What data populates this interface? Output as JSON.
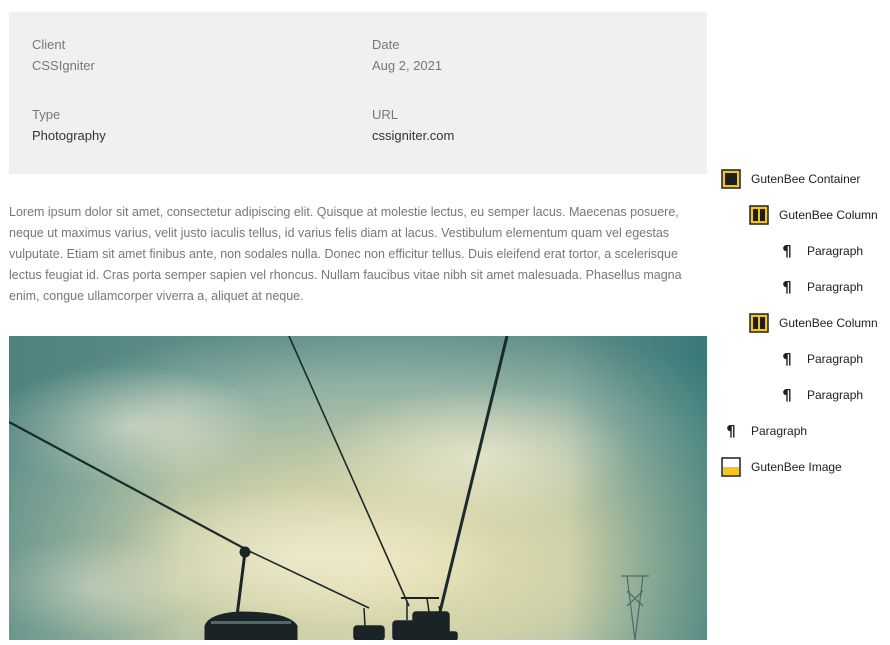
{
  "meta": {
    "client": {
      "label": "Client",
      "value": "CSSIgniter"
    },
    "date": {
      "label": "Date",
      "value": "Aug 2, 2021"
    },
    "type": {
      "label": "Type",
      "value": "Photography"
    },
    "url": {
      "label": "URL",
      "value": "cssigniter.com"
    }
  },
  "content": {
    "paragraph": "Lorem ipsum dolor sit amet, consectetur adipiscing elit. Quisque at molestie lectus, eu semper lacus. Maecenas posuere, neque ut maximus varius, velit justo iaculis tellus, id varius felis diam at lacus. Vestibulum elementum quam vel egestas vulputate. Etiam sit amet finibus ante, non sodales nulla. Donec non efficitur tellus. Duis eleifend erat tortor, a scelerisque lectus feugiat id. Cras porta semper sapien vel rhoncus. Nullam faucibus vitae nibh sit amet malesuada. Phasellus magna enim, congue ullamcorper viverra a, aliquet at neque."
  },
  "block_nav": {
    "items": [
      {
        "label": "GutenBee Container",
        "icon": "container-icon"
      },
      {
        "label": "GutenBee Column",
        "icon": "columns-icon"
      },
      {
        "label": "Paragraph",
        "icon": "paragraph-icon"
      },
      {
        "label": "Paragraph",
        "icon": "paragraph-icon"
      },
      {
        "label": "GutenBee Column",
        "icon": "columns-icon"
      },
      {
        "label": "Paragraph",
        "icon": "paragraph-icon"
      },
      {
        "label": "Paragraph",
        "icon": "paragraph-icon"
      },
      {
        "label": "Paragraph",
        "icon": "paragraph-icon"
      },
      {
        "label": "GutenBee Image",
        "icon": "image-icon"
      }
    ]
  },
  "colors": {
    "gutenbee_accent": "#f5c518",
    "meta_background": "#f0f0f0"
  }
}
